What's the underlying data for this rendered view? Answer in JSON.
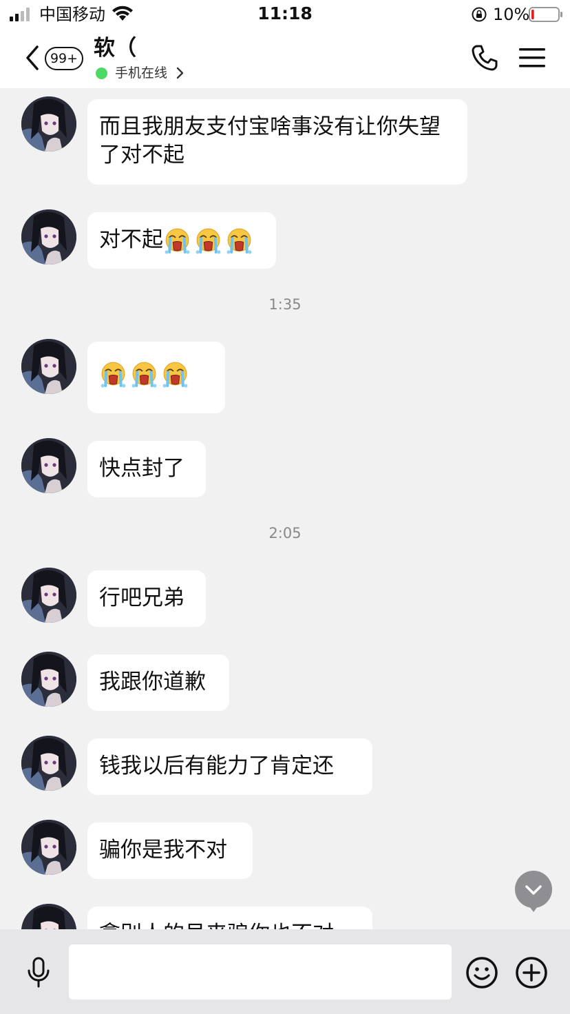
{
  "status_bar": {
    "carrier": "中国移动",
    "time": "11:18",
    "battery_percent": "10%",
    "battery_level": 0.1,
    "icons": [
      "signal-icon",
      "wifi-icon",
      "orientation-lock-icon",
      "battery-icon"
    ]
  },
  "nav": {
    "back_badge": "99+",
    "contact_name": "软（",
    "online_status": "手机在线",
    "icons": [
      "back-icon",
      "chevron-right-icon",
      "phone-icon",
      "menu-icon"
    ],
    "online_color": "#4cd964"
  },
  "messages": [
    {
      "type": "text",
      "text": "而且我朋友支付宝啥事没有让你失望了对不起",
      "sender": "contact"
    },
    {
      "type": "text",
      "text": "对不起",
      "emoji_count": 3,
      "emoji": "crying-face-icon",
      "sender": "contact"
    },
    {
      "type": "time",
      "text": "1:35"
    },
    {
      "type": "emoji",
      "emoji_count": 3,
      "emoji": "crying-face-icon",
      "sender": "contact"
    },
    {
      "type": "text",
      "text": "快点封了",
      "sender": "contact"
    },
    {
      "type": "time",
      "text": "2:05"
    },
    {
      "type": "text",
      "text": "行吧兄弟",
      "sender": "contact"
    },
    {
      "type": "text",
      "text": "我跟你道歉",
      "sender": "contact"
    },
    {
      "type": "text",
      "text": "钱我以后有能力了肯定还",
      "sender": "contact"
    },
    {
      "type": "text",
      "text": "骗你是我不对",
      "sender": "contact"
    },
    {
      "type": "text",
      "text": "拿别人的号来骗你也不对",
      "sender": "contact",
      "partially_visible": true
    }
  ],
  "input": {
    "value": "",
    "placeholder": "",
    "icons": [
      "microphone-icon",
      "emoji-icon",
      "plus-icon",
      "scroll-down-icon"
    ]
  },
  "colors": {
    "background": "#f1f1f1",
    "bubble": "#ffffff",
    "input_bar": "#e6e6e8",
    "scroll_button": "#8e8e93"
  }
}
